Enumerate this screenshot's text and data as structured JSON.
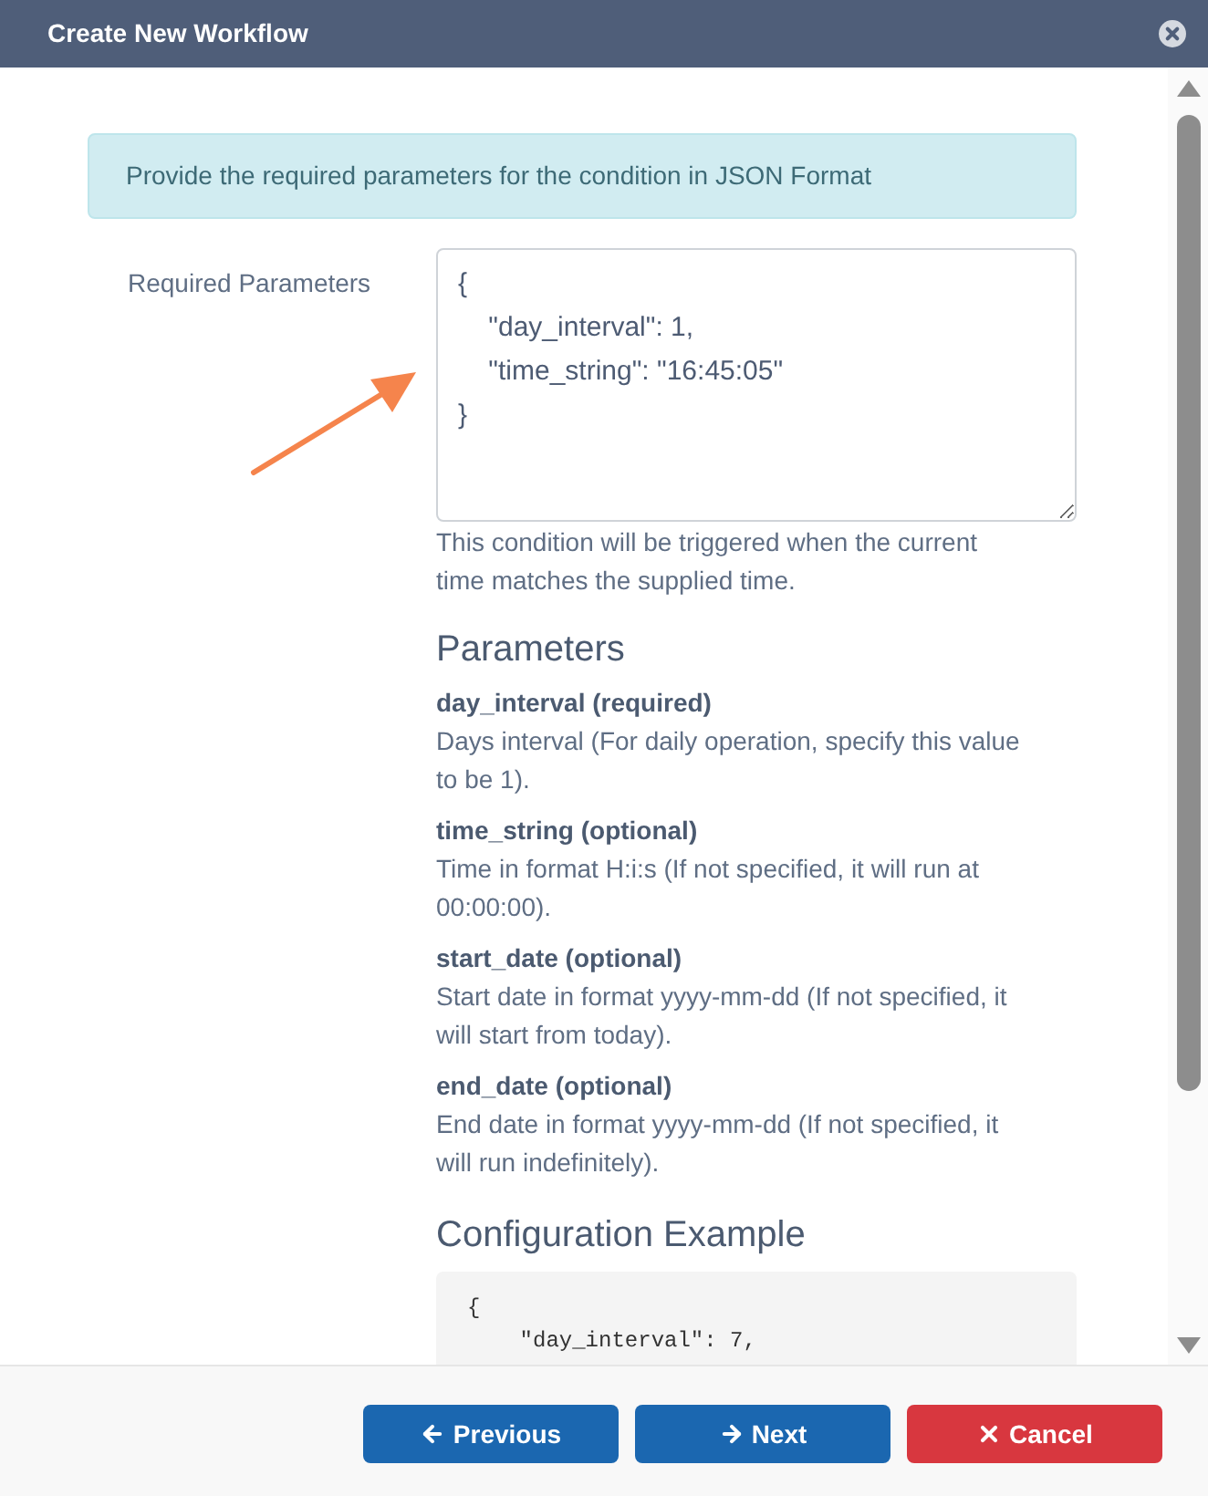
{
  "window": {
    "title": "Create New Workflow"
  },
  "alert": {
    "text": "Provide the required parameters for the condition in JSON Format"
  },
  "form": {
    "label": "Required Parameters",
    "value": "{\n    \"day_interval\": 1,\n    \"time_string\": \"16:45:05\"\n}",
    "help": "This condition will be triggered when the current time matches the supplied time."
  },
  "parameters": {
    "heading": "Parameters",
    "items": [
      {
        "name": "day_interval (required)",
        "description": "Days interval (For daily operation, specify this value to be 1)."
      },
      {
        "name": "time_string (optional)",
        "description": "Time in format H:i:s (If not specified, it will run at 00:00:00)."
      },
      {
        "name": "start_date (optional)",
        "description": "Start date in format yyyy-mm-dd (If not specified, it will start from today)."
      },
      {
        "name": "end_date (optional)",
        "description": "End date in format yyyy-mm-dd (If not specified, it will run indefinitely)."
      }
    ]
  },
  "example": {
    "heading": "Configuration Example",
    "code": [
      "{",
      "    \"day_interval\": 7,"
    ]
  },
  "buttons": [
    {
      "kind": "previous",
      "label": "Previous"
    },
    {
      "kind": "next",
      "label": "Next"
    },
    {
      "kind": "cancel",
      "label": "Cancel"
    }
  ]
}
